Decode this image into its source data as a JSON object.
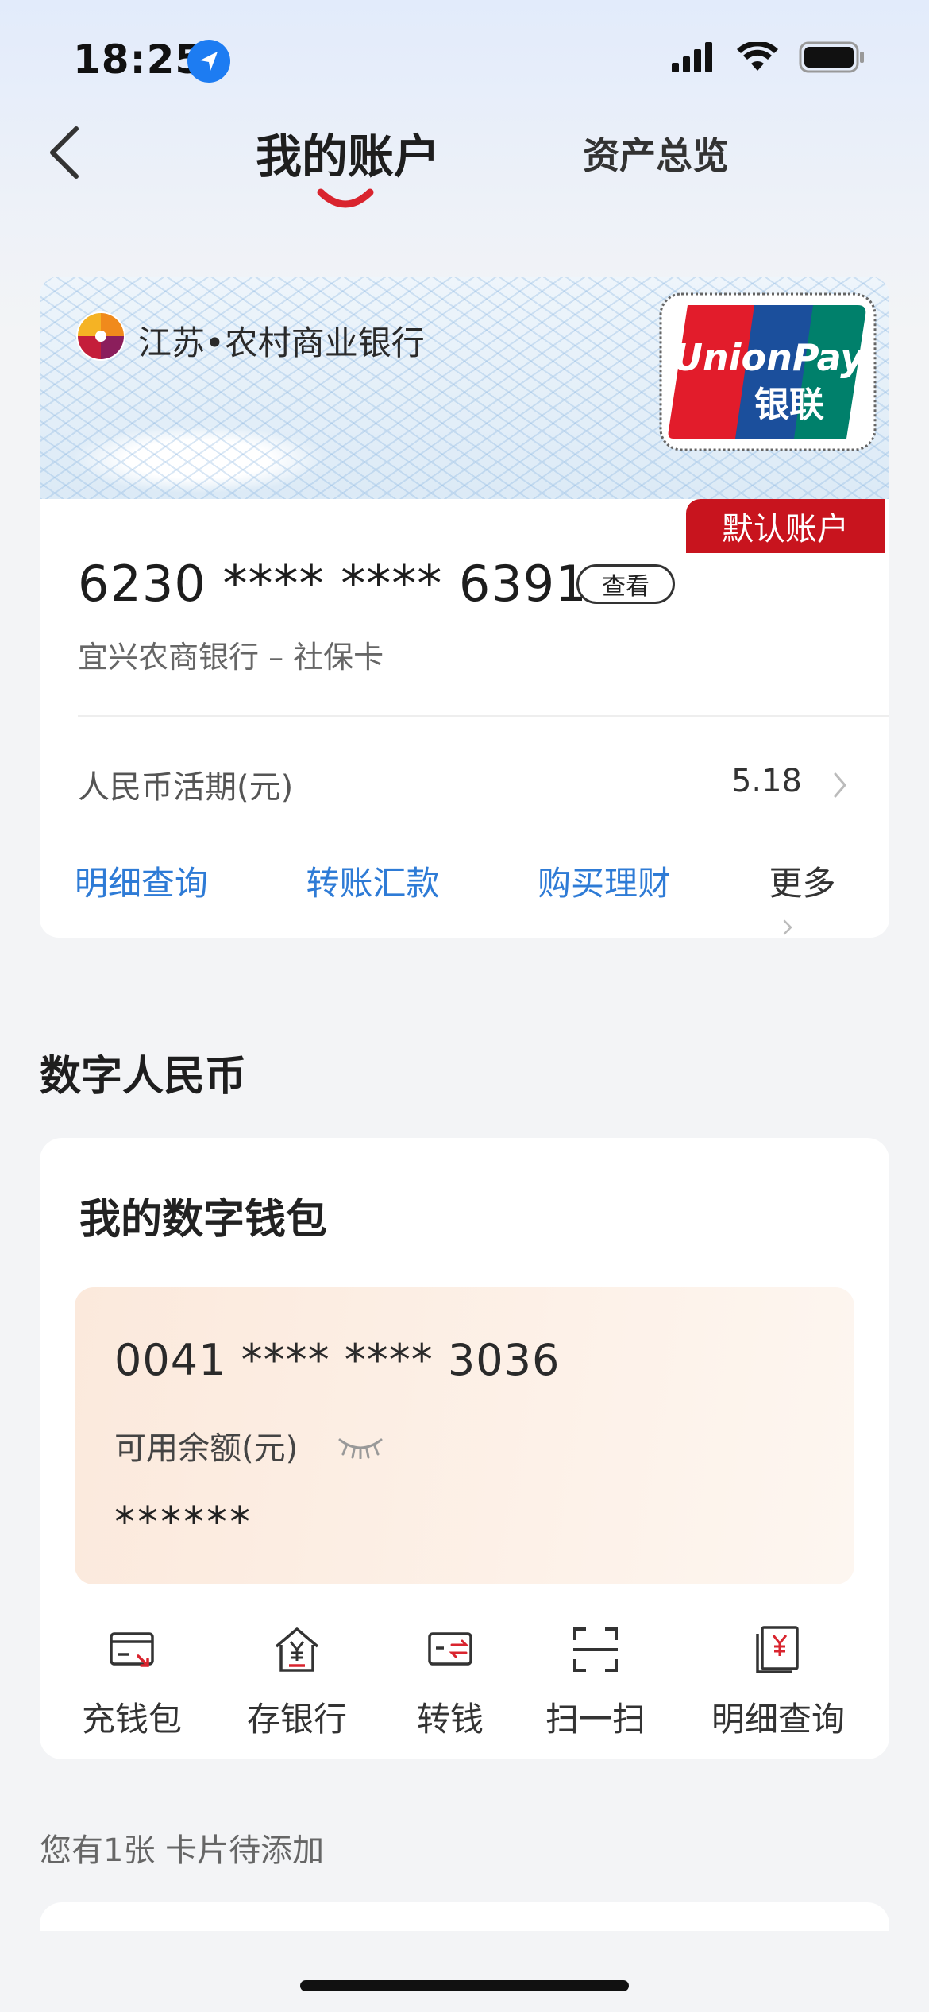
{
  "status_bar": {
    "time": "18:25"
  },
  "nav": {
    "title": "我的账户",
    "tab_overview": "资产总览"
  },
  "bank_card": {
    "bank_name": "江苏•农村商业银行",
    "network_brand": "UnionPay",
    "network_brand_cn": "银联",
    "default_badge": "默认账户",
    "card_number": "6230 **** **** 6391",
    "view_label": "查看",
    "card_subtitle": "宜兴农商银行 – 社保卡",
    "account_label": "人民币活期(元)",
    "account_balance": "5.18",
    "actions": [
      "明细查询",
      "转账汇款",
      "购买理财"
    ],
    "more_label": "更多"
  },
  "digital_rmb": {
    "section_title": "数字人民币",
    "wallet_title": "我的数字钱包",
    "wallet_number": "0041 **** **** 3036",
    "balance_label": "可用余额(元)",
    "balance_value": "******",
    "actions": [
      {
        "label": "充钱包",
        "icon": "wallet-topup-icon"
      },
      {
        "label": "存银行",
        "icon": "bank-deposit-icon"
      },
      {
        "label": "转钱",
        "icon": "transfer-icon"
      },
      {
        "label": "扫一扫",
        "icon": "scan-icon"
      },
      {
        "label": "明细查询",
        "icon": "details-icon"
      }
    ]
  },
  "pending": {
    "text": "您有1张 卡片待添加"
  },
  "colors": {
    "accent_blue": "#2e7bd6",
    "brand_red": "#c8141e",
    "unionpay_red": "#e21c2b",
    "unionpay_blue": "#1b4f9c",
    "unionpay_green": "#00806b"
  }
}
